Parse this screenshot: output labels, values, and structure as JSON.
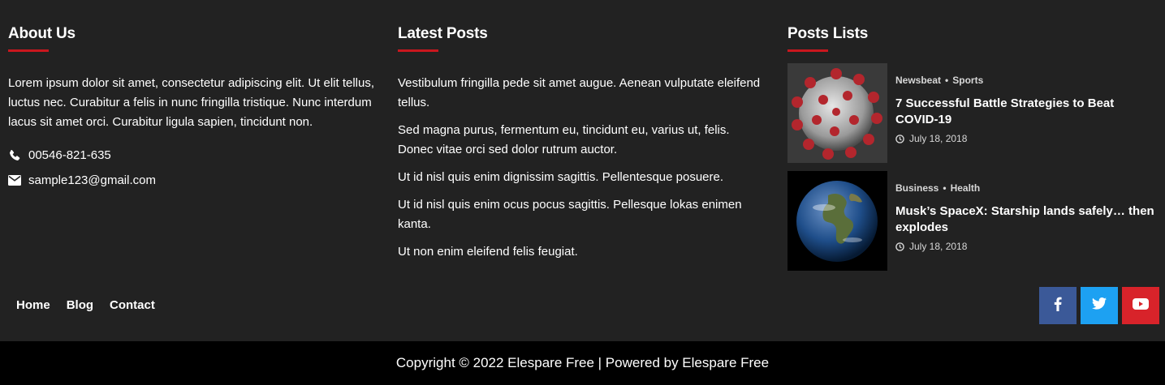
{
  "colors": {
    "background": "#222222",
    "accent": "#c9171e",
    "copyright_bg": "#000000",
    "facebook": "#3b5998",
    "twitter": "#1da1f2",
    "youtube": "#d8232a"
  },
  "about": {
    "title": "About Us",
    "text": "Lorem ipsum dolor sit amet, consectetur adipiscing elit. Ut elit tellus, luctus nec. Curabitur a felis in nunc fringilla tristique. Nunc interdum lacus sit amet orci. Curabitur ligula sapien, tincidunt non.",
    "phone_icon": "phone-icon",
    "phone": "00546-821-635",
    "email_icon": "envelope-icon",
    "email": "sample123@gmail.com"
  },
  "latest": {
    "title": "Latest Posts",
    "items": [
      "Vestibulum fringilla pede sit amet augue. Aenean vulputate eleifend tellus.",
      "Sed magna purus, fermentum eu, tincidunt eu, varius ut, felis. Donec vitae orci sed dolor rutrum auctor.",
      "Ut id nisl quis enim dignissim sagittis. Pellentesque posuere.",
      "Ut id nisl quis enim ocus pocus sagittis. Pellesque lokas enimen kanta.",
      "Ut non enim eleifend felis feugiat."
    ]
  },
  "lists": {
    "title": "Posts Lists",
    "posts": [
      {
        "cat1": "Newsbeat",
        "cat2": "Sports",
        "separator": "•",
        "title": "7 Successful Battle Strategies to Beat COVID-19",
        "date": "July 18, 2018",
        "image": "coronavirus-image"
      },
      {
        "cat1": "Business",
        "cat2": "Health",
        "separator": "•",
        "title": "Musk’s SpaceX: Starship lands safely… then explodes",
        "date": "July 18, 2018",
        "image": "earth-image"
      }
    ]
  },
  "footer_nav": {
    "home": "Home",
    "blog": "Blog",
    "contact": "Contact"
  },
  "social": {
    "facebook_icon": "facebook-icon",
    "twitter_icon": "twitter-icon",
    "youtube_icon": "youtube-icon"
  },
  "copyright": "Copyright © 2022 Elespare Free | Powered by Elespare Free"
}
